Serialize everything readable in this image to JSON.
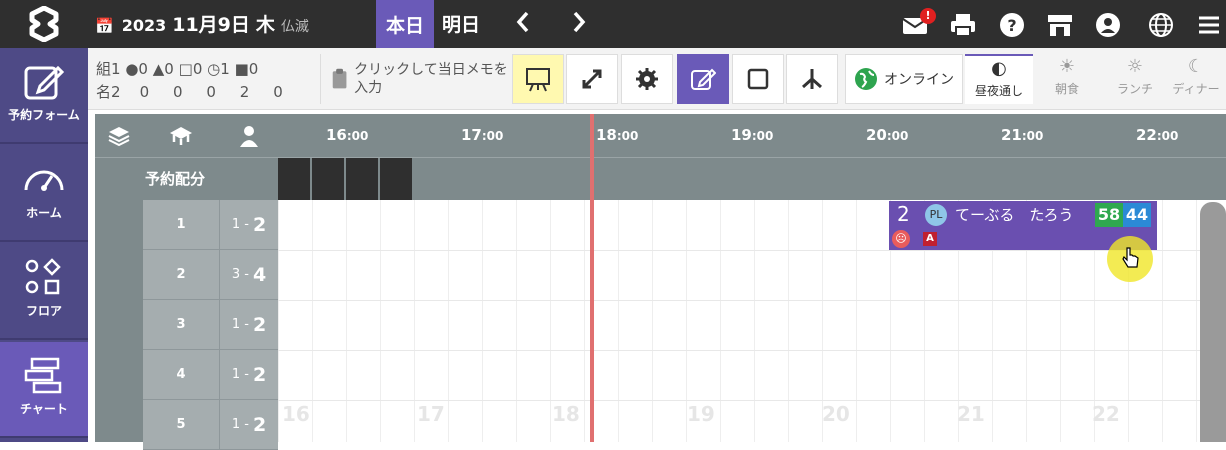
{
  "header": {
    "year": "2023",
    "date": "11月9日",
    "weekday": "木",
    "rokuyo": "仏滅",
    "today_label": "本日",
    "tomorrow_label": "明日",
    "prev_icon": "chevron-left-icon",
    "next_icon": "chevron-right-icon",
    "mail_badge": "!",
    "icons": [
      "mail-icon",
      "print-icon",
      "help-icon",
      "store-icon",
      "account-icon",
      "globe-icon",
      "menu-icon"
    ]
  },
  "sidebar": {
    "items": [
      {
        "label": "予約フォーム",
        "icon": "edit-form-icon"
      },
      {
        "label": "ホーム",
        "icon": "speedometer-icon"
      },
      {
        "label": "フロア",
        "icon": "floor-shapes-icon"
      },
      {
        "label": "チャート",
        "icon": "chart-icon"
      }
    ],
    "active_index": 3
  },
  "toolbar": {
    "counts_row1": [
      "組1",
      "0",
      "0",
      "0",
      "1",
      "0"
    ],
    "counts_row2": [
      "名2",
      "0",
      "0",
      "0",
      "2",
      "0"
    ],
    "memo_text": "クリックして当日メモを入力",
    "online_label": "オンライン",
    "modes": [
      {
        "label": "昼夜通し",
        "icon": "half-moon-icon"
      },
      {
        "label": "朝食",
        "icon": "sunrise-icon"
      },
      {
        "label": "ランチ",
        "icon": "sun-icon"
      },
      {
        "label": "ディナー",
        "icon": "moon-icon"
      }
    ]
  },
  "grid": {
    "alloc_label": "予約配分",
    "hours": [
      {
        "h": "16",
        "m": ":00"
      },
      {
        "h": "17",
        "m": ":00"
      },
      {
        "h": "18",
        "m": ":00"
      },
      {
        "h": "19",
        "m": ":00"
      },
      {
        "h": "20",
        "m": ":00"
      },
      {
        "h": "21",
        "m": ":00"
      },
      {
        "h": "22",
        "m": ":00"
      }
    ],
    "faint_hours": [
      "16",
      "17",
      "18",
      "19",
      "20",
      "21",
      "22"
    ],
    "rows": [
      {
        "table": "1",
        "cap_min": "1 -",
        "cap_max": "2"
      },
      {
        "table": "2",
        "cap_min": "3 -",
        "cap_max": "4"
      },
      {
        "table": "3",
        "cap_min": "1 -",
        "cap_max": "2"
      },
      {
        "table": "4",
        "cap_min": "1 -",
        "cap_max": "2"
      },
      {
        "table": "5",
        "cap_min": "1 -",
        "cap_max": "2"
      }
    ]
  },
  "reservation": {
    "party": "2",
    "channel": "PL",
    "name": "てーぶる　たろう",
    "badge_green": "58",
    "badge_blue": "44",
    "tag": "A",
    "colors": {
      "block": "#6a4fb0",
      "green": "#2fa84f",
      "blue": "#2b8ad6"
    }
  },
  "colors": {
    "accent": "#6a5ab8",
    "sidebar": "#4e4a86",
    "topbar": "#2f2f2f",
    "grid_header": "#7e8a8c"
  }
}
